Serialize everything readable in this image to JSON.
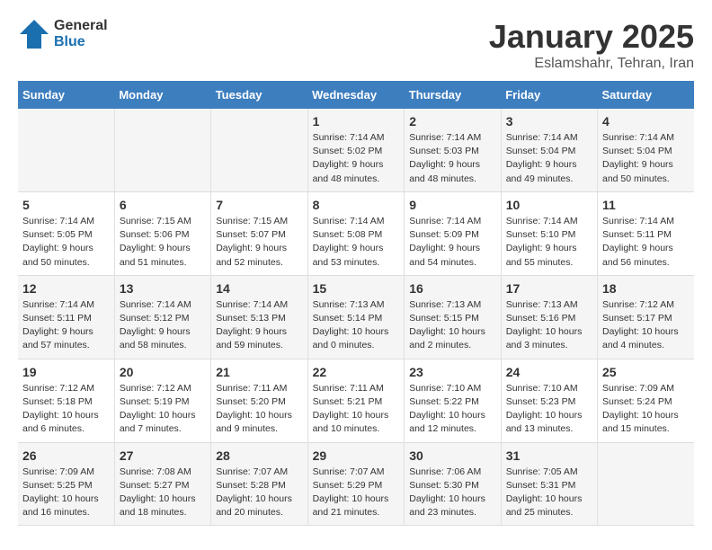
{
  "header": {
    "logo_general": "General",
    "logo_blue": "Blue",
    "month_title": "January 2025",
    "location": "Eslamshahr, Tehran, Iran"
  },
  "weekdays": [
    "Sunday",
    "Monday",
    "Tuesday",
    "Wednesday",
    "Thursday",
    "Friday",
    "Saturday"
  ],
  "weeks": [
    [
      {
        "day": "",
        "info": ""
      },
      {
        "day": "",
        "info": ""
      },
      {
        "day": "",
        "info": ""
      },
      {
        "day": "1",
        "info": "Sunrise: 7:14 AM\nSunset: 5:02 PM\nDaylight: 9 hours\nand 48 minutes."
      },
      {
        "day": "2",
        "info": "Sunrise: 7:14 AM\nSunset: 5:03 PM\nDaylight: 9 hours\nand 48 minutes."
      },
      {
        "day": "3",
        "info": "Sunrise: 7:14 AM\nSunset: 5:04 PM\nDaylight: 9 hours\nand 49 minutes."
      },
      {
        "day": "4",
        "info": "Sunrise: 7:14 AM\nSunset: 5:04 PM\nDaylight: 9 hours\nand 50 minutes."
      }
    ],
    [
      {
        "day": "5",
        "info": "Sunrise: 7:14 AM\nSunset: 5:05 PM\nDaylight: 9 hours\nand 50 minutes."
      },
      {
        "day": "6",
        "info": "Sunrise: 7:15 AM\nSunset: 5:06 PM\nDaylight: 9 hours\nand 51 minutes."
      },
      {
        "day": "7",
        "info": "Sunrise: 7:15 AM\nSunset: 5:07 PM\nDaylight: 9 hours\nand 52 minutes."
      },
      {
        "day": "8",
        "info": "Sunrise: 7:14 AM\nSunset: 5:08 PM\nDaylight: 9 hours\nand 53 minutes."
      },
      {
        "day": "9",
        "info": "Sunrise: 7:14 AM\nSunset: 5:09 PM\nDaylight: 9 hours\nand 54 minutes."
      },
      {
        "day": "10",
        "info": "Sunrise: 7:14 AM\nSunset: 5:10 PM\nDaylight: 9 hours\nand 55 minutes."
      },
      {
        "day": "11",
        "info": "Sunrise: 7:14 AM\nSunset: 5:11 PM\nDaylight: 9 hours\nand 56 minutes."
      }
    ],
    [
      {
        "day": "12",
        "info": "Sunrise: 7:14 AM\nSunset: 5:11 PM\nDaylight: 9 hours\nand 57 minutes."
      },
      {
        "day": "13",
        "info": "Sunrise: 7:14 AM\nSunset: 5:12 PM\nDaylight: 9 hours\nand 58 minutes."
      },
      {
        "day": "14",
        "info": "Sunrise: 7:14 AM\nSunset: 5:13 PM\nDaylight: 9 hours\nand 59 minutes."
      },
      {
        "day": "15",
        "info": "Sunrise: 7:13 AM\nSunset: 5:14 PM\nDaylight: 10 hours\nand 0 minutes."
      },
      {
        "day": "16",
        "info": "Sunrise: 7:13 AM\nSunset: 5:15 PM\nDaylight: 10 hours\nand 2 minutes."
      },
      {
        "day": "17",
        "info": "Sunrise: 7:13 AM\nSunset: 5:16 PM\nDaylight: 10 hours\nand 3 minutes."
      },
      {
        "day": "18",
        "info": "Sunrise: 7:12 AM\nSunset: 5:17 PM\nDaylight: 10 hours\nand 4 minutes."
      }
    ],
    [
      {
        "day": "19",
        "info": "Sunrise: 7:12 AM\nSunset: 5:18 PM\nDaylight: 10 hours\nand 6 minutes."
      },
      {
        "day": "20",
        "info": "Sunrise: 7:12 AM\nSunset: 5:19 PM\nDaylight: 10 hours\nand 7 minutes."
      },
      {
        "day": "21",
        "info": "Sunrise: 7:11 AM\nSunset: 5:20 PM\nDaylight: 10 hours\nand 9 minutes."
      },
      {
        "day": "22",
        "info": "Sunrise: 7:11 AM\nSunset: 5:21 PM\nDaylight: 10 hours\nand 10 minutes."
      },
      {
        "day": "23",
        "info": "Sunrise: 7:10 AM\nSunset: 5:22 PM\nDaylight: 10 hours\nand 12 minutes."
      },
      {
        "day": "24",
        "info": "Sunrise: 7:10 AM\nSunset: 5:23 PM\nDaylight: 10 hours\nand 13 minutes."
      },
      {
        "day": "25",
        "info": "Sunrise: 7:09 AM\nSunset: 5:24 PM\nDaylight: 10 hours\nand 15 minutes."
      }
    ],
    [
      {
        "day": "26",
        "info": "Sunrise: 7:09 AM\nSunset: 5:25 PM\nDaylight: 10 hours\nand 16 minutes."
      },
      {
        "day": "27",
        "info": "Sunrise: 7:08 AM\nSunset: 5:27 PM\nDaylight: 10 hours\nand 18 minutes."
      },
      {
        "day": "28",
        "info": "Sunrise: 7:07 AM\nSunset: 5:28 PM\nDaylight: 10 hours\nand 20 minutes."
      },
      {
        "day": "29",
        "info": "Sunrise: 7:07 AM\nSunset: 5:29 PM\nDaylight: 10 hours\nand 21 minutes."
      },
      {
        "day": "30",
        "info": "Sunrise: 7:06 AM\nSunset: 5:30 PM\nDaylight: 10 hours\nand 23 minutes."
      },
      {
        "day": "31",
        "info": "Sunrise: 7:05 AM\nSunset: 5:31 PM\nDaylight: 10 hours\nand 25 minutes."
      },
      {
        "day": "",
        "info": ""
      }
    ]
  ]
}
